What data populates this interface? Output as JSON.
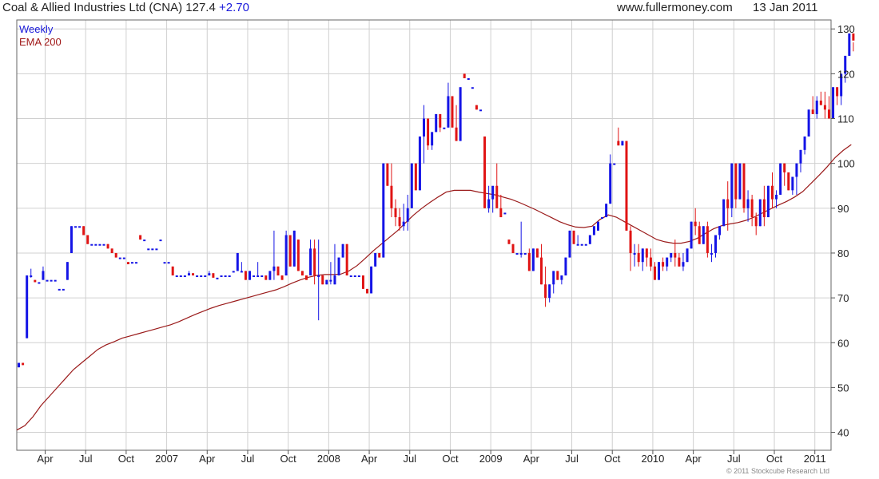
{
  "header": {
    "title": "Coal & Allied Industries Ltd (CNA) 127.4",
    "change": "+2.70",
    "site": "www.fullermoney.com",
    "date": "13 Jan 2011"
  },
  "legend": {
    "period": "Weekly",
    "ema": "EMA 200",
    "period_color": "#1a1adb",
    "ema_color": "#a01818"
  },
  "copyright": "© 2011 Stockcube Research Ltd",
  "colors": {
    "up": "#1414e6",
    "down": "#e01414",
    "ema": "#9a1a1a",
    "grid": "#d0d0d0"
  },
  "chart_data": {
    "type": "candlestick",
    "ylim": [
      36,
      132
    ],
    "y_ticks": [
      40,
      50,
      60,
      70,
      80,
      90,
      100,
      110,
      120,
      130
    ],
    "x_range": [
      0,
      201
    ],
    "x_ticks": [
      {
        "label": "Apr",
        "x": 7
      },
      {
        "label": "Jul",
        "x": 17
      },
      {
        "label": "Oct",
        "x": 27
      },
      {
        "label": "2007",
        "x": 37
      },
      {
        "label": "Apr",
        "x": 47
      },
      {
        "label": "Jul",
        "x": 57
      },
      {
        "label": "Oct",
        "x": 67
      },
      {
        "label": "2008",
        "x": 77
      },
      {
        "label": "Apr",
        "x": 87
      },
      {
        "label": "Jul",
        "x": 97
      },
      {
        "label": "Oct",
        "x": 107
      },
      {
        "label": "2009",
        "x": 117
      },
      {
        "label": "Apr",
        "x": 127
      },
      {
        "label": "Jul",
        "x": 137
      },
      {
        "label": "Oct",
        "x": 147
      },
      {
        "label": "2010",
        "x": 157
      },
      {
        "label": "Apr",
        "x": 167
      },
      {
        "label": "Jul",
        "x": 177
      },
      {
        "label": "Oct",
        "x": 187
      },
      {
        "label": "2011",
        "x": 197
      }
    ],
    "ohlc": [
      [
        54.5,
        55.5,
        54.5,
        55.5
      ],
      [
        55.5,
        55.5,
        55,
        55
      ],
      [
        61,
        75,
        61,
        75
      ],
      [
        75,
        76.5,
        74.5,
        75
      ],
      [
        74,
        74,
        73.5,
        73.5
      ],
      [
        73.5,
        73.5,
        73.5,
        73.5
      ],
      [
        74,
        77,
        74,
        76
      ],
      [
        74,
        74,
        74,
        74
      ],
      [
        74,
        74,
        74,
        74
      ],
      [
        74,
        74,
        74,
        74
      ],
      [
        72,
        72,
        72,
        72
      ],
      [
        72,
        72,
        72,
        72
      ],
      [
        74,
        78,
        74,
        78
      ],
      [
        80,
        86,
        80,
        86
      ],
      [
        86,
        86,
        86,
        86
      ],
      [
        86,
        86,
        86,
        86
      ],
      [
        86,
        86,
        84,
        84
      ],
      [
        84,
        84,
        82,
        82
      ],
      [
        82,
        82,
        82,
        82
      ],
      [
        82,
        82,
        82,
        82
      ],
      [
        82,
        82,
        82,
        82
      ],
      [
        82,
        82,
        82,
        82
      ],
      [
        82,
        82,
        81,
        81
      ],
      [
        81,
        81,
        80,
        80
      ],
      [
        80,
        80,
        79,
        79
      ],
      [
        79,
        79,
        79,
        79
      ],
      [
        79,
        79,
        79,
        79
      ],
      [
        78,
        78,
        77.5,
        77.5
      ],
      [
        78,
        78,
        78,
        78
      ],
      [
        78,
        78,
        78,
        78
      ],
      [
        84,
        84,
        83,
        83
      ],
      [
        83,
        83,
        83,
        83
      ],
      [
        81,
        81,
        81,
        81
      ],
      [
        81,
        81,
        81,
        81
      ],
      [
        81,
        81,
        81,
        81
      ],
      [
        83,
        83,
        83,
        83
      ],
      [
        78,
        78,
        78,
        78
      ],
      [
        78,
        78,
        78,
        78
      ],
      [
        77,
        77,
        75,
        75
      ],
      [
        75,
        75,
        75,
        75
      ],
      [
        75,
        75,
        75,
        75
      ],
      [
        75,
        75,
        75,
        75
      ],
      [
        75,
        76,
        75,
        75.5
      ],
      [
        75.5,
        75.5,
        75,
        75
      ],
      [
        75,
        75,
        75,
        75
      ],
      [
        75,
        75,
        75,
        75
      ],
      [
        75,
        75,
        75,
        75
      ],
      [
        75,
        76,
        75,
        75.5
      ],
      [
        75.5,
        75.5,
        74.5,
        74.5
      ],
      [
        74.5,
        74.5,
        74.5,
        74.5
      ],
      [
        75,
        75,
        75,
        75
      ],
      [
        75,
        75,
        75,
        75
      ],
      [
        75,
        75,
        75,
        75
      ],
      [
        76,
        76,
        76,
        76
      ],
      [
        76,
        80,
        76,
        80
      ],
      [
        76,
        78,
        76,
        76
      ],
      [
        76,
        76,
        74,
        74
      ],
      [
        74,
        76,
        74,
        76
      ],
      [
        75,
        75,
        75,
        75
      ],
      [
        75,
        78,
        75,
        75
      ],
      [
        75,
        75,
        75,
        75
      ],
      [
        75,
        75,
        74,
        74
      ],
      [
        74,
        76,
        74,
        76
      ],
      [
        76,
        85,
        74,
        77
      ],
      [
        77,
        77,
        75,
        75
      ],
      [
        75,
        75,
        74,
        74
      ],
      [
        75,
        85,
        75,
        84
      ],
      [
        84,
        84,
        77,
        77
      ],
      [
        77,
        85,
        77,
        85
      ],
      [
        83,
        83,
        76,
        76
      ],
      [
        76,
        76,
        75,
        75
      ],
      [
        75,
        75,
        74,
        74
      ],
      [
        75,
        83,
        75,
        81
      ],
      [
        81,
        83,
        73,
        75
      ],
      [
        75,
        83,
        65,
        75
      ],
      [
        75,
        75,
        73,
        73
      ],
      [
        73,
        74,
        73,
        74
      ],
      [
        74,
        78,
        73,
        74
      ],
      [
        73,
        82,
        73,
        75
      ],
      [
        75,
        79,
        75,
        79
      ],
      [
        79,
        82,
        79,
        82
      ],
      [
        82,
        82,
        75,
        75
      ],
      [
        75,
        75,
        75,
        75
      ],
      [
        75,
        75,
        75,
        75
      ],
      [
        75,
        75,
        75,
        75
      ],
      [
        75,
        75,
        72,
        72
      ],
      [
        72,
        72,
        71,
        71
      ],
      [
        71,
        77,
        71,
        77
      ],
      [
        77,
        80,
        77,
        80
      ],
      [
        80,
        80,
        79,
        79
      ],
      [
        79,
        100,
        79,
        100
      ],
      [
        100,
        100,
        95,
        95
      ],
      [
        95,
        100,
        88,
        90
      ],
      [
        90,
        92,
        86,
        88
      ],
      [
        88,
        90,
        85,
        86
      ],
      [
        86,
        91,
        85,
        87
      ],
      [
        87,
        93,
        85,
        90
      ],
      [
        90,
        100,
        90,
        100
      ],
      [
        100,
        100,
        94,
        94
      ],
      [
        94,
        106,
        94,
        106
      ],
      [
        106,
        113,
        100,
        110
      ],
      [
        110,
        110,
        103,
        104
      ],
      [
        104,
        107,
        103,
        107
      ],
      [
        107,
        111,
        107,
        111
      ],
      [
        111,
        111,
        107,
        108
      ],
      [
        108,
        108,
        108,
        108
      ],
      [
        108,
        118,
        108,
        115
      ],
      [
        115,
        115,
        108,
        108
      ],
      [
        108,
        113,
        105,
        105
      ],
      [
        105,
        117,
        105,
        117
      ],
      [
        120,
        120,
        119,
        119
      ],
      [
        119,
        119,
        119,
        119
      ],
      [
        117,
        117,
        117,
        117
      ],
      [
        113,
        113,
        112,
        112
      ],
      [
        112,
        112,
        112,
        112
      ],
      [
        106,
        106,
        90,
        90
      ],
      [
        90,
        95,
        89,
        92
      ],
      [
        92,
        93,
        89,
        95
      ],
      [
        95,
        100,
        90,
        90
      ],
      [
        90,
        93,
        88,
        88
      ],
      [
        89,
        89,
        89,
        89
      ],
      [
        83,
        83,
        82,
        82
      ],
      [
        82,
        82,
        80,
        80
      ],
      [
        80,
        80,
        80,
        80
      ],
      [
        80,
        87,
        79,
        80
      ],
      [
        80,
        80,
        80,
        80
      ],
      [
        80,
        81,
        76,
        76
      ],
      [
        76,
        81,
        76,
        81
      ],
      [
        81,
        81,
        79,
        79
      ],
      [
        79,
        82,
        73,
        73
      ],
      [
        73,
        77,
        68,
        70
      ],
      [
        70,
        73,
        69,
        73
      ],
      [
        73,
        76,
        71,
        76
      ],
      [
        76,
        76,
        74,
        74
      ],
      [
        74,
        75,
        73,
        75
      ],
      [
        75,
        79,
        75,
        79
      ],
      [
        79,
        85,
        79,
        85
      ],
      [
        85,
        85,
        82,
        82
      ],
      [
        82,
        84,
        82,
        82
      ],
      [
        82,
        82,
        82,
        82
      ],
      [
        82,
        82,
        82,
        82
      ],
      [
        82,
        84,
        82,
        84
      ],
      [
        84,
        86,
        84,
        86
      ],
      [
        85,
        87,
        85,
        87
      ],
      [
        88,
        88,
        88,
        88
      ],
      [
        88,
        91,
        88,
        91
      ],
      [
        91,
        102,
        91,
        100
      ],
      [
        100,
        100,
        100,
        100
      ],
      [
        105,
        108,
        104,
        104
      ],
      [
        104,
        105,
        104,
        105
      ],
      [
        105,
        105,
        85,
        85
      ],
      [
        85,
        86,
        76,
        80
      ],
      [
        80,
        82,
        77,
        80
      ],
      [
        80,
        82,
        77,
        78
      ],
      [
        78,
        81,
        76,
        81
      ],
      [
        81,
        81,
        77,
        79
      ],
      [
        79,
        81,
        76,
        77
      ],
      [
        77,
        78,
        74,
        74
      ],
      [
        74,
        78,
        74,
        78
      ],
      [
        78,
        79,
        76,
        77
      ],
      [
        77,
        79,
        76,
        79
      ],
      [
        79,
        80,
        78,
        80
      ],
      [
        80,
        83,
        77,
        79
      ],
      [
        79,
        80,
        77,
        77
      ],
      [
        77,
        80,
        76,
        78
      ],
      [
        78,
        81,
        78,
        81
      ],
      [
        81,
        87,
        81,
        87
      ],
      [
        87,
        90,
        84,
        86
      ],
      [
        86,
        87,
        82,
        82
      ],
      [
        82,
        86,
        82,
        86
      ],
      [
        86,
        87,
        79,
        80
      ],
      [
        80,
        82,
        78,
        80
      ],
      [
        80,
        84,
        79,
        84
      ],
      [
        84,
        86,
        83,
        86
      ],
      [
        86,
        92,
        86,
        92
      ],
      [
        92,
        96,
        85,
        90
      ],
      [
        90,
        100,
        88,
        100
      ],
      [
        100,
        100,
        90,
        92
      ],
      [
        92,
        100,
        92,
        100
      ],
      [
        100,
        100,
        89,
        90
      ],
      [
        90,
        94,
        87,
        92
      ],
      [
        92,
        93,
        86,
        88
      ],
      [
        88,
        89,
        84,
        86
      ],
      [
        86,
        92,
        86,
        92
      ],
      [
        92,
        95,
        86,
        88
      ],
      [
        88,
        95,
        88,
        95
      ],
      [
        95,
        98,
        90,
        92
      ],
      [
        92,
        94,
        90,
        93
      ],
      [
        93,
        100,
        93,
        100
      ],
      [
        100,
        100,
        95,
        98
      ],
      [
        98,
        97,
        94,
        94
      ],
      [
        94,
        97,
        93,
        97
      ],
      [
        97,
        100,
        93,
        100
      ],
      [
        100,
        103,
        98,
        103
      ],
      [
        103,
        106,
        102,
        106
      ],
      [
        106,
        112,
        106,
        112
      ],
      [
        112,
        115,
        111,
        111
      ],
      [
        111,
        115,
        110,
        114
      ],
      [
        114,
        116,
        113,
        113
      ],
      [
        113,
        116,
        110,
        112
      ],
      [
        112,
        115,
        110,
        110
      ],
      [
        110,
        117,
        110,
        117
      ],
      [
        117,
        117,
        113,
        115
      ],
      [
        115,
        120,
        113,
        120
      ],
      [
        120,
        124,
        118,
        124
      ],
      [
        124,
        129,
        124,
        129
      ],
      [
        129,
        127,
        125,
        127.4
      ]
    ],
    "ema_200": [
      [
        0,
        40.5
      ],
      [
        2,
        41.5
      ],
      [
        4,
        43.5
      ],
      [
        6,
        46
      ],
      [
        8,
        48
      ],
      [
        10,
        50
      ],
      [
        12,
        52
      ],
      [
        14,
        54
      ],
      [
        16,
        55.5
      ],
      [
        18,
        57
      ],
      [
        20,
        58.5
      ],
      [
        22,
        59.5
      ],
      [
        24,
        60.2
      ],
      [
        26,
        61
      ],
      [
        28,
        61.5
      ],
      [
        30,
        62
      ],
      [
        32,
        62.5
      ],
      [
        34,
        63
      ],
      [
        36,
        63.5
      ],
      [
        38,
        64
      ],
      [
        40,
        64.7
      ],
      [
        42,
        65.5
      ],
      [
        44,
        66.3
      ],
      [
        46,
        67
      ],
      [
        48,
        67.7
      ],
      [
        50,
        68.3
      ],
      [
        52,
        68.8
      ],
      [
        54,
        69.3
      ],
      [
        56,
        69.8
      ],
      [
        58,
        70.3
      ],
      [
        60,
        70.8
      ],
      [
        62,
        71.3
      ],
      [
        64,
        71.8
      ],
      [
        66,
        72.5
      ],
      [
        68,
        73.3
      ],
      [
        70,
        74
      ],
      [
        72,
        74.6
      ],
      [
        74,
        75
      ],
      [
        76,
        75.2
      ],
      [
        78,
        75.2
      ],
      [
        80,
        75.3
      ],
      [
        82,
        76
      ],
      [
        84,
        77.2
      ],
      [
        86,
        78.8
      ],
      [
        88,
        80.5
      ],
      [
        90,
        82
      ],
      [
        92,
        83.5
      ],
      [
        94,
        85
      ],
      [
        96,
        86.8
      ],
      [
        98,
        88.5
      ],
      [
        100,
        90
      ],
      [
        102,
        91.3
      ],
      [
        104,
        92.5
      ],
      [
        106,
        93.6
      ],
      [
        108,
        94
      ],
      [
        110,
        94
      ],
      [
        112,
        94
      ],
      [
        114,
        93.6
      ],
      [
        116,
        93.3
      ],
      [
        118,
        93
      ],
      [
        120,
        92.5
      ],
      [
        122,
        92
      ],
      [
        124,
        91.3
      ],
      [
        126,
        90.5
      ],
      [
        128,
        89.7
      ],
      [
        130,
        88.8
      ],
      [
        132,
        87.9
      ],
      [
        134,
        87
      ],
      [
        136,
        86.3
      ],
      [
        138,
        85.8
      ],
      [
        140,
        85.7
      ],
      [
        142,
        86
      ],
      [
        144,
        87.5
      ],
      [
        146,
        88.5
      ],
      [
        148,
        88
      ],
      [
        150,
        87
      ],
      [
        152,
        86
      ],
      [
        154,
        85
      ],
      [
        156,
        84
      ],
      [
        158,
        83
      ],
      [
        160,
        82.5
      ],
      [
        162,
        82.2
      ],
      [
        164,
        82.2
      ],
      [
        166,
        82.6
      ],
      [
        168,
        83.3
      ],
      [
        170,
        84.4
      ],
      [
        172,
        85.4
      ],
      [
        174,
        86.1
      ],
      [
        176,
        86.5
      ],
      [
        178,
        86.8
      ],
      [
        180,
        87.3
      ],
      [
        182,
        88
      ],
      [
        184,
        88.9
      ],
      [
        186,
        89.8
      ],
      [
        188,
        90.7
      ],
      [
        190,
        91.5
      ],
      [
        192,
        92.5
      ],
      [
        194,
        93.7
      ],
      [
        196,
        95.5
      ],
      [
        198,
        97.3
      ],
      [
        200,
        99.2
      ],
      [
        202,
        101.3
      ],
      [
        204,
        102.9
      ],
      [
        206,
        104.2
      ]
    ]
  }
}
